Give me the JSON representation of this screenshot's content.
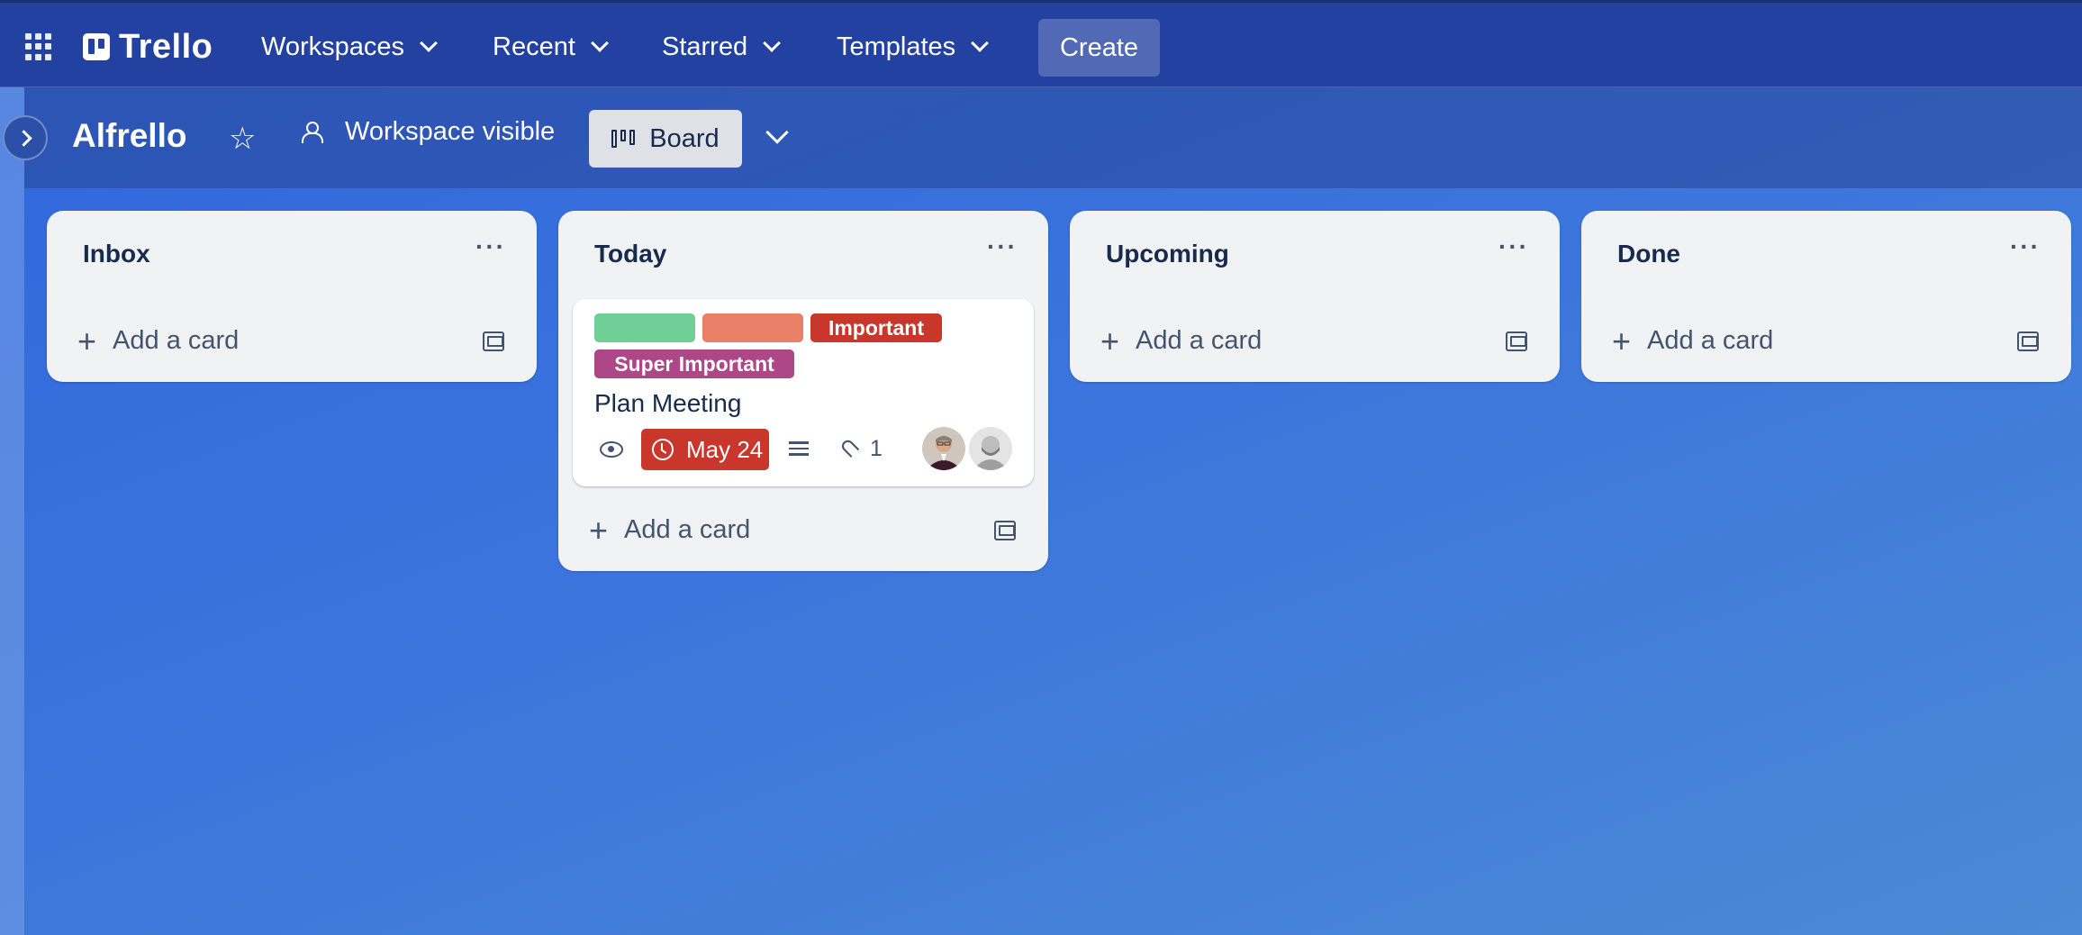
{
  "nav": {
    "brand": "Trello",
    "menus": [
      {
        "label": "Workspaces"
      },
      {
        "label": "Recent"
      },
      {
        "label": "Starred"
      },
      {
        "label": "Templates"
      }
    ],
    "create_label": "Create"
  },
  "board": {
    "title": "Alfrello",
    "visibility": "Workspace visible",
    "view_label": "Board"
  },
  "lists": [
    {
      "title": "Inbox",
      "add_label": "Add a card"
    },
    {
      "title": "Today",
      "add_label": "Add a card"
    },
    {
      "title": "Upcoming",
      "add_label": "Add a card"
    },
    {
      "title": "Done",
      "add_label": "Add a card"
    }
  ],
  "card": {
    "labels": [
      {
        "text": "",
        "color": "#6fcf97"
      },
      {
        "text": "",
        "color": "#ea8068"
      },
      {
        "text": "Important",
        "color": "#c9372c"
      },
      {
        "text": "Super Important",
        "color": "#ae4787"
      }
    ],
    "title": "Plan Meeting",
    "due": "May 24",
    "attachments": "1"
  },
  "colors": {
    "nav_bg": "#2241a0",
    "list_bg": "#f1f2f4",
    "due_bg": "#c9372c"
  }
}
